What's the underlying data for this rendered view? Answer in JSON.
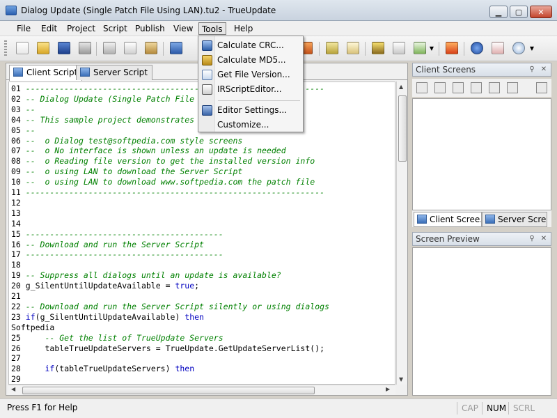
{
  "window": {
    "title": "Dialog Update (Single Patch File Using LAN).tu2 - TrueUpdate"
  },
  "menu": [
    {
      "label": "File",
      "underline": "F"
    },
    {
      "label": "Edit",
      "underline": "E"
    },
    {
      "label": "Project",
      "underline": "P"
    },
    {
      "label": "Script",
      "underline": "S"
    },
    {
      "label": "Publish",
      "underline": "u"
    },
    {
      "label": "View",
      "underline": "V"
    },
    {
      "label": "Tools",
      "underline": "T"
    },
    {
      "label": "Help",
      "underline": "H"
    }
  ],
  "tools_menu": [
    {
      "label": "Calculate CRC..."
    },
    {
      "label": "Calculate MD5..."
    },
    {
      "label": "Get File Version..."
    },
    {
      "label": "IRScriptEditor..."
    },
    {
      "label": "Editor Settings..."
    },
    {
      "label": "Customize..."
    }
  ],
  "editor": {
    "tabs": [
      "Client Script",
      "Server Script"
    ],
    "lines": [
      {
        "n": "01",
        "segs": [
          {
            "t": "--------------------------------------------------------------",
            "c": "comment"
          }
        ]
      },
      {
        "n": "02",
        "segs": [
          {
            "t": "-- Dialog Update (Single Patch File",
            "c": "comment"
          }
        ]
      },
      {
        "n": "03",
        "segs": [
          {
            "t": "--",
            "c": "comment"
          }
        ]
      },
      {
        "n": "04",
        "segs": [
          {
            "t": "-- This sample project demonstrates",
            "c": "comment"
          }
        ]
      },
      {
        "n": "05",
        "segs": [
          {
            "t": "--",
            "c": "comment"
          }
        ]
      },
      {
        "n": "06",
        "segs": [
          {
            "t": "--  o Dialog test@softpedia.com style screens",
            "c": "comment"
          }
        ]
      },
      {
        "n": "07",
        "segs": [
          {
            "t": "--  o No interface is shown unless an update is needed",
            "c": "comment"
          }
        ]
      },
      {
        "n": "08",
        "segs": [
          {
            "t": "--  o Reading file version to get the installed version info",
            "c": "comment"
          }
        ]
      },
      {
        "n": "09",
        "segs": [
          {
            "t": "--  o using LAN to download the Server Script",
            "c": "comment"
          }
        ]
      },
      {
        "n": "10",
        "segs": [
          {
            "t": "--  o using LAN to download www.softpedia.com the patch file",
            "c": "comment"
          }
        ]
      },
      {
        "n": "11",
        "segs": [
          {
            "t": "--------------------------------------------------------------",
            "c": "comment"
          }
        ]
      },
      {
        "n": "12",
        "segs": []
      },
      {
        "n": "13",
        "segs": []
      },
      {
        "n": "14",
        "segs": []
      },
      {
        "n": "15",
        "segs": [
          {
            "t": "-----------------------------------------",
            "c": "comment"
          }
        ]
      },
      {
        "n": "16",
        "segs": [
          {
            "t": "-- Download and run the Server Script",
            "c": "comment"
          }
        ]
      },
      {
        "n": "17",
        "segs": [
          {
            "t": "-----------------------------------------",
            "c": "comment"
          }
        ]
      },
      {
        "n": "18",
        "segs": []
      },
      {
        "n": "19",
        "segs": [
          {
            "t": "-- Suppress all dialogs until an update is available?",
            "c": "comment"
          }
        ]
      },
      {
        "n": "20",
        "segs": [
          {
            "t": "g_SilentUntilUpdateAvailable = ",
            "c": "plain"
          },
          {
            "t": "true",
            "c": "key"
          },
          {
            "t": ";",
            "c": "plain"
          }
        ]
      },
      {
        "n": "21",
        "segs": []
      },
      {
        "n": "22",
        "segs": [
          {
            "t": "-- Download and run the Server Script silently or using dialogs",
            "c": "comment"
          }
        ]
      },
      {
        "n": "23",
        "segs": [
          {
            "t": "if",
            "c": "key"
          },
          {
            "t": "(g_SilentUntilUpdateAvailable) ",
            "c": "plain"
          },
          {
            "t": "then",
            "c": "key"
          }
        ]
      },
      {
        "n": "",
        "segs": [
          {
            "t": "Softpedia",
            "c": "plain"
          }
        ]
      },
      {
        "n": "25",
        "segs": [
          {
            "t": "    -- Get the list of TrueUpdate Servers",
            "c": "comment"
          }
        ]
      },
      {
        "n": "26",
        "segs": [
          {
            "t": "    tableTrueUpdateServers = TrueUpdate.GetUpdateServerList();",
            "c": "plain"
          }
        ]
      },
      {
        "n": "27",
        "segs": []
      },
      {
        "n": "28",
        "segs": [
          {
            "t": "    ",
            "c": "plain"
          },
          {
            "t": "if",
            "c": "key"
          },
          {
            "t": "(tableTrueUpdateServers) ",
            "c": "plain"
          },
          {
            "t": "then",
            "c": "key"
          }
        ]
      },
      {
        "n": "29",
        "segs": []
      }
    ]
  },
  "client_screens": {
    "title": "Client Screens",
    "tabs": [
      "Client Scree...",
      "Server Scre..."
    ]
  },
  "screen_preview": {
    "title": "Screen Preview"
  },
  "status": {
    "text": "Press F1 for Help",
    "indicators": [
      {
        "label": "CAP",
        "on": false
      },
      {
        "label": "NUM",
        "on": true
      },
      {
        "label": "SCRL",
        "on": false
      }
    ]
  },
  "colors": {
    "comment": "#008000",
    "keyword": "#0000c0"
  }
}
